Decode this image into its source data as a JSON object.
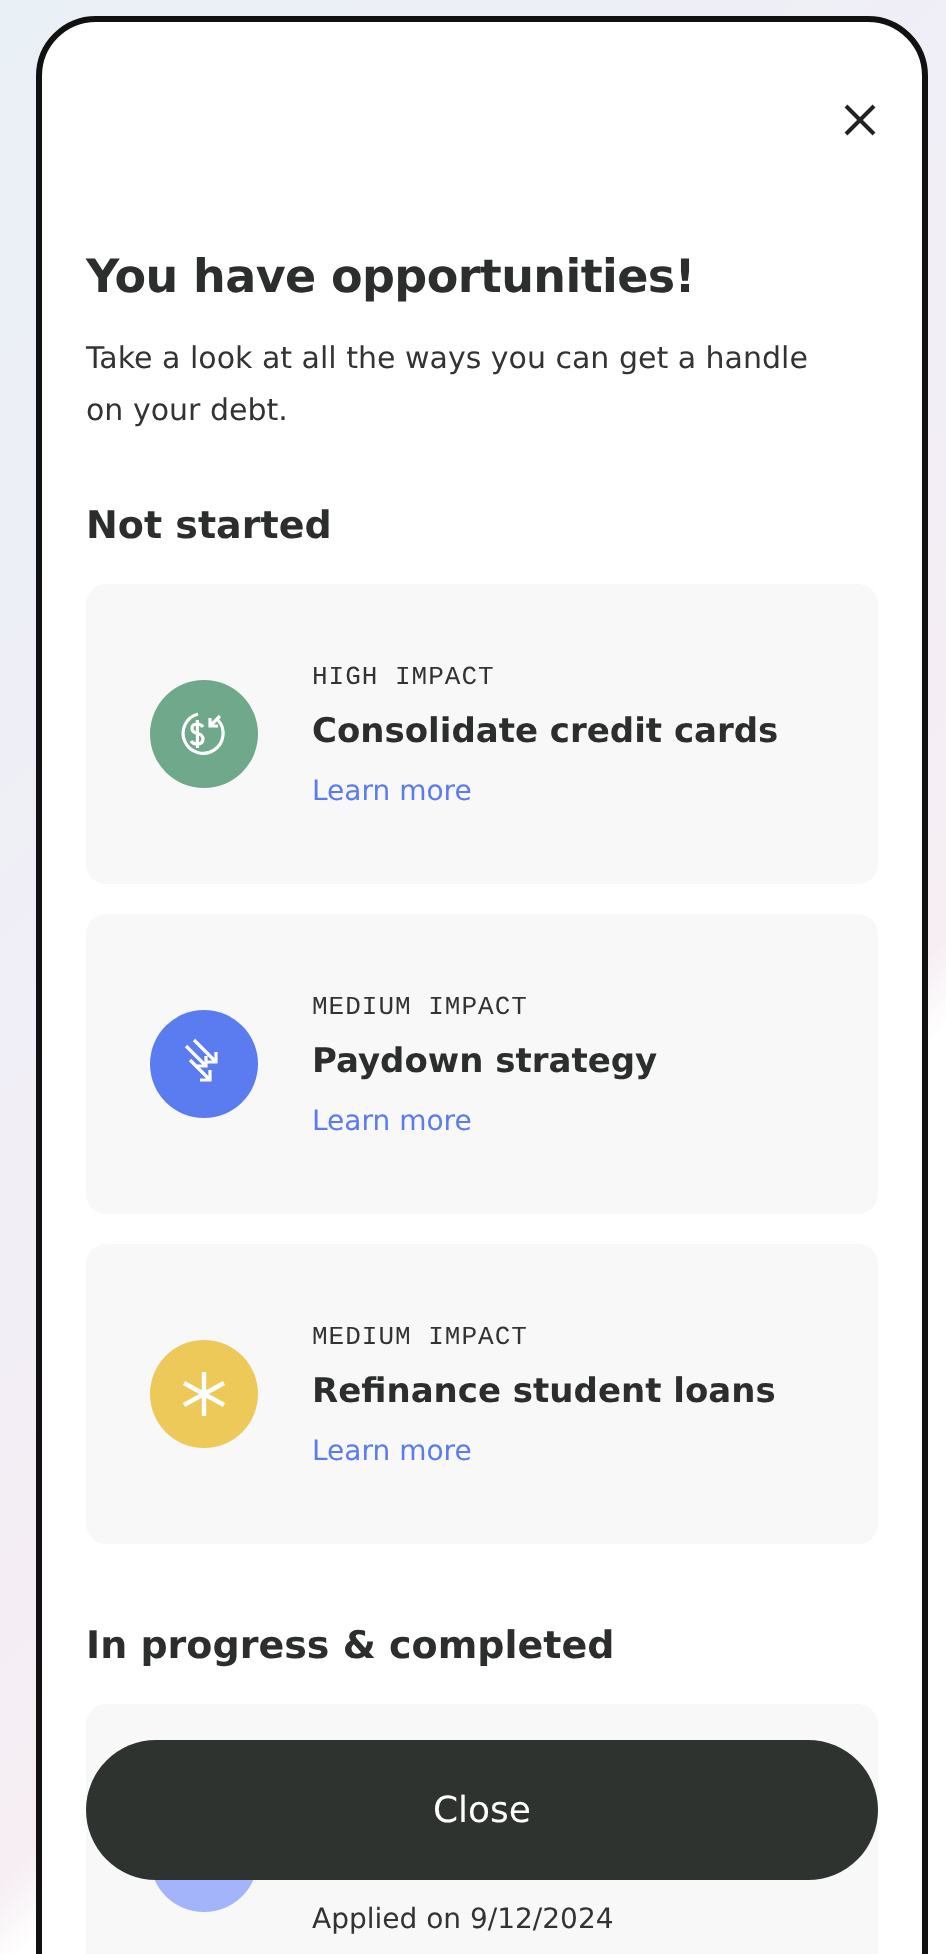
{
  "title": "You have opportunities!",
  "subtitle": "Take a look at all the ways you can get a handle on your debt.",
  "sections": [
    {
      "heading": "Not started",
      "items": [
        {
          "kind": "consolidate",
          "color": "#6fa88a",
          "impact": "HIGH IMPACT",
          "name": "Consolidate credit cards",
          "link": "Learn more"
        },
        {
          "kind": "paydown",
          "color": "#5b7cf0",
          "impact": "MEDIUM IMPACT",
          "name": "Paydown strategy",
          "link": "Learn more"
        },
        {
          "kind": "refinance",
          "color": "#edc95a",
          "impact": "MEDIUM IMPACT",
          "name": "Refinance student loans",
          "link": "Learn more"
        }
      ]
    },
    {
      "heading": "In progress & completed",
      "items": [
        {
          "kind": "applied",
          "color": "#a3b4fa",
          "status": "Applied on 9/12/2024"
        }
      ]
    }
  ],
  "close_button": "Close"
}
